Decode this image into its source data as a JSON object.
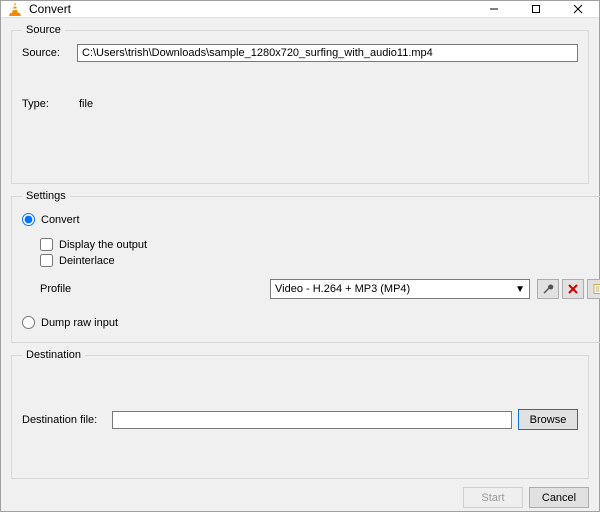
{
  "window": {
    "title": "Convert"
  },
  "source": {
    "group_label": "Source",
    "source_label": "Source:",
    "source_path": "C:\\Users\\trish\\Downloads\\sample_1280x720_surfing_with_audio11.mp4",
    "type_label": "Type:",
    "type_value": "file"
  },
  "settings": {
    "group_label": "Settings",
    "convert_label": "Convert",
    "display_output_label": "Display the output",
    "deinterlace_label": "Deinterlace",
    "profile_label": "Profile",
    "profile_selected": "Video - H.264 + MP3 (MP4)",
    "dump_raw_label": "Dump raw input"
  },
  "destination": {
    "group_label": "Destination",
    "dest_file_label": "Destination file:",
    "dest_file_value": "",
    "browse_label": "Browse"
  },
  "buttons": {
    "start": "Start",
    "cancel": "Cancel"
  }
}
